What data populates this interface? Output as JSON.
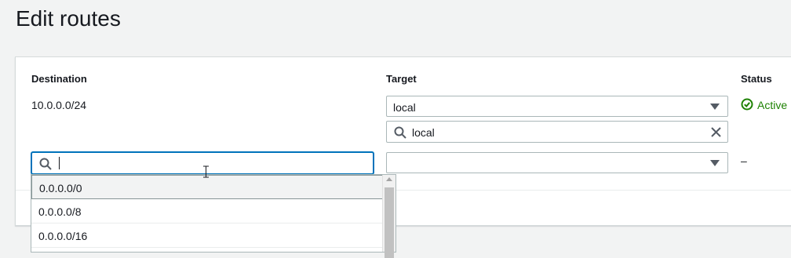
{
  "page": {
    "title": "Edit routes"
  },
  "table": {
    "headers": {
      "destination": "Destination",
      "target": "Target",
      "status": "Status"
    },
    "rows": [
      {
        "destination": "10.0.0.0/24",
        "target": "local",
        "target_filter": "local",
        "status": "Active"
      },
      {
        "destination": "",
        "target": "",
        "status": "–"
      }
    ]
  },
  "destination_suggestions": [
    "0.0.0.0/0",
    "0.0.0.0/8",
    "0.0.0.0/16"
  ],
  "colors": {
    "focus": "#0073bb",
    "active": "#1d8102"
  },
  "icons": [
    "search-icon",
    "clear-icon",
    "chevron-down-icon",
    "check-circle-icon",
    "text-cursor-icon"
  ]
}
